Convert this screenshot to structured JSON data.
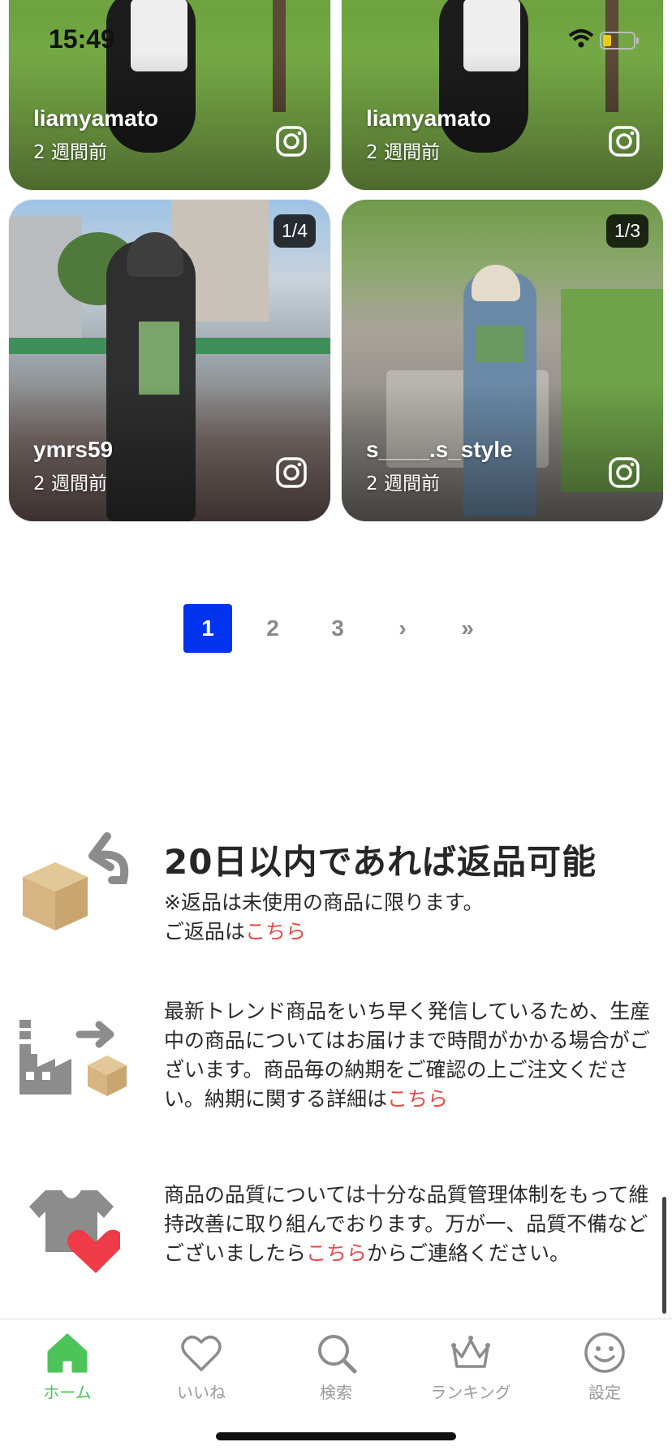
{
  "status_bar": {
    "time": "15:49"
  },
  "cards": [
    {
      "user": "liamyamato",
      "posted": "2 週間前",
      "count": "",
      "icon": "instagram-icon"
    },
    {
      "user": "liamyamato",
      "posted": "2 週間前",
      "count": "",
      "icon": "instagram-icon"
    },
    {
      "user": "ymrs59",
      "posted": "2 週間前",
      "count": "1/4",
      "icon": "instagram-icon"
    },
    {
      "user": "s____.s_style",
      "posted": "2 週間前",
      "count": "1/3",
      "icon": "instagram-icon"
    }
  ],
  "pagination": {
    "pages": [
      "1",
      "2",
      "3"
    ],
    "current": "1",
    "next": "›",
    "last": "»"
  },
  "info": {
    "returns": {
      "title": "20日以内であれば返品可能",
      "line1": "※返品は未使用の商品に限ります。",
      "line2_prefix": "ご返品は",
      "link": "こちら"
    },
    "delivery": {
      "text": "最新トレンド商品をいち早く発信しているため、生産中の商品についてはお届けまで時間がかかる場合がございます。商品毎の納期をご確認の上ご注文ください。納期に関する詳細は",
      "link": "こちら"
    },
    "quality": {
      "text_prefix": "商品の品質については十分な品質管理体制をもって維持改善に取り組んでおります。万が一、品質不備などございましたら",
      "link": "こちら",
      "text_suffix": "からご連絡ください。"
    }
  },
  "tabs": [
    {
      "label": "ホーム",
      "icon": "home-icon",
      "active": true
    },
    {
      "label": "いいね",
      "icon": "heart-icon",
      "active": false
    },
    {
      "label": "検索",
      "icon": "search-icon",
      "active": false
    },
    {
      "label": "ランキング",
      "icon": "crown-icon",
      "active": false
    },
    {
      "label": "設定",
      "icon": "smiley-icon",
      "active": false
    }
  ],
  "colors": {
    "accent_blue": "#0033ee",
    "link_red": "#e84a4a",
    "tab_active_green": "#4cc45a",
    "box_tan": "#d6b582",
    "icon_gray": "#8c8c8c",
    "heart_red": "#ef3b47"
  }
}
